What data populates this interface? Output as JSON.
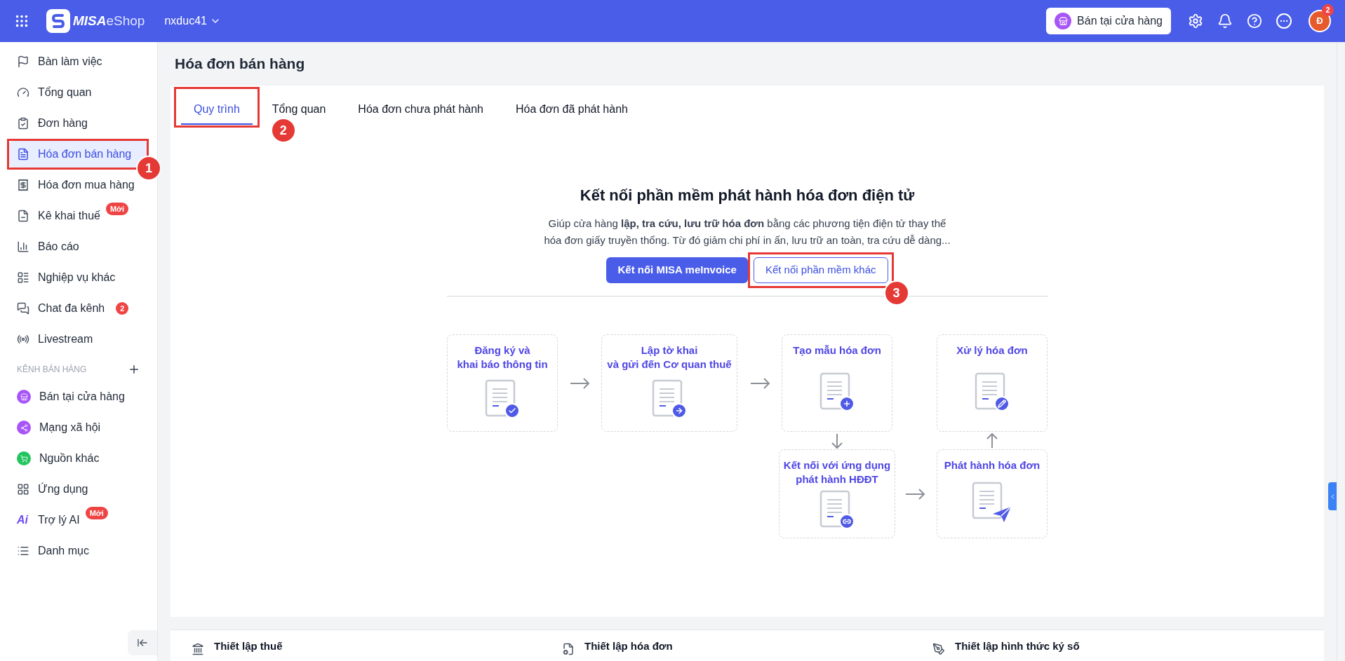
{
  "topbar": {
    "brand_bold": "MISA",
    "brand_light": "eShop",
    "account": "nxduc41",
    "store_button": "Bán tại cửa hàng",
    "avatar": "Đ",
    "notification_count": "2"
  },
  "sidebar": {
    "items": [
      {
        "label": "Bàn làm việc",
        "selected": false
      },
      {
        "label": "Tổng quan",
        "selected": false
      },
      {
        "label": "Đơn hàng",
        "selected": false
      },
      {
        "label": "Hóa đơn bán hàng",
        "selected": true,
        "callout": "1"
      },
      {
        "label": "Hóa đơn mua hàng",
        "selected": false
      },
      {
        "label": "Kê khai thuế",
        "selected": false,
        "tag": "Mới"
      },
      {
        "label": "Báo cáo",
        "selected": false
      },
      {
        "label": "Nghiệp vụ khác",
        "selected": false
      },
      {
        "label": "Chat đa kênh",
        "selected": false,
        "count": "2"
      },
      {
        "label": "Livestream",
        "selected": false
      }
    ],
    "section_title": "KÊNH BÁN HÀNG",
    "channels": [
      {
        "label": "Bán tại cửa hàng",
        "color": "#a855f7",
        "kind": "store"
      },
      {
        "label": "Mạng xã hội",
        "color": "#a855f7",
        "kind": "social"
      },
      {
        "label": "Nguồn khác",
        "color": "#22c55e",
        "kind": "cart"
      }
    ],
    "extra_items": [
      {
        "label": "Ứng dụng",
        "kind": "apps"
      },
      {
        "label": "Trợ lý AI",
        "kind": "ai",
        "icon_text": "Ai",
        "tag": "Mới"
      },
      {
        "label": "Danh mục",
        "kind": "list"
      }
    ]
  },
  "page_title": "Hóa đơn bán hàng",
  "tabs": [
    {
      "label": "Quy trình",
      "selected": true,
      "callout": "2"
    },
    {
      "label": "Tổng quan",
      "selected": false
    },
    {
      "label": "Hóa đơn chưa phát hành",
      "selected": false
    },
    {
      "label": "Hóa đơn đã phát hành",
      "selected": false
    }
  ],
  "intro": {
    "heading": "Kết nối phần mềm phát hành hóa đơn điện tử",
    "lines": [
      "Giúp cửa hàng **lập, tra cứu, lưu trữ hóa đơn** bằng các phương tiện điện tử thay thế",
      "hóa đơn giấy truyền thống. Từ đó giảm chi phí in ấn, lưu trữ an toàn, tra cứu dễ dàng..."
    ],
    "buttons": [
      {
        "label": "Kết nối MISA meInvoice",
        "kind": "primary"
      },
      {
        "label": "Kết nối phần mềm khác",
        "kind": "outline",
        "callout": "3"
      }
    ]
  },
  "steps": [
    {
      "title": "Đăng ký và\nkhai báo thông tin",
      "kind": "check"
    },
    {
      "title": "Lập tờ khai\nvà gửi đến Cơ quan thuế",
      "kind": "arrow"
    },
    {
      "title": "Tạo mẫu hóa đơn",
      "kind": "plus"
    },
    {
      "title": "Xử lý hóa đơn",
      "kind": "edit"
    },
    {
      "title": "Kết nối với ứng dụng\nphát hành HĐĐT",
      "kind": "link"
    },
    {
      "title": "Phát hành hóa đơn",
      "kind": "send"
    }
  ],
  "settings": [
    {
      "label": "Thiết lập thuế",
      "kind": "bank"
    },
    {
      "label": "Thiết lập hóa đơn",
      "kind": "file"
    },
    {
      "label": "Thiết lập hình thức ký số",
      "kind": "pen"
    }
  ]
}
